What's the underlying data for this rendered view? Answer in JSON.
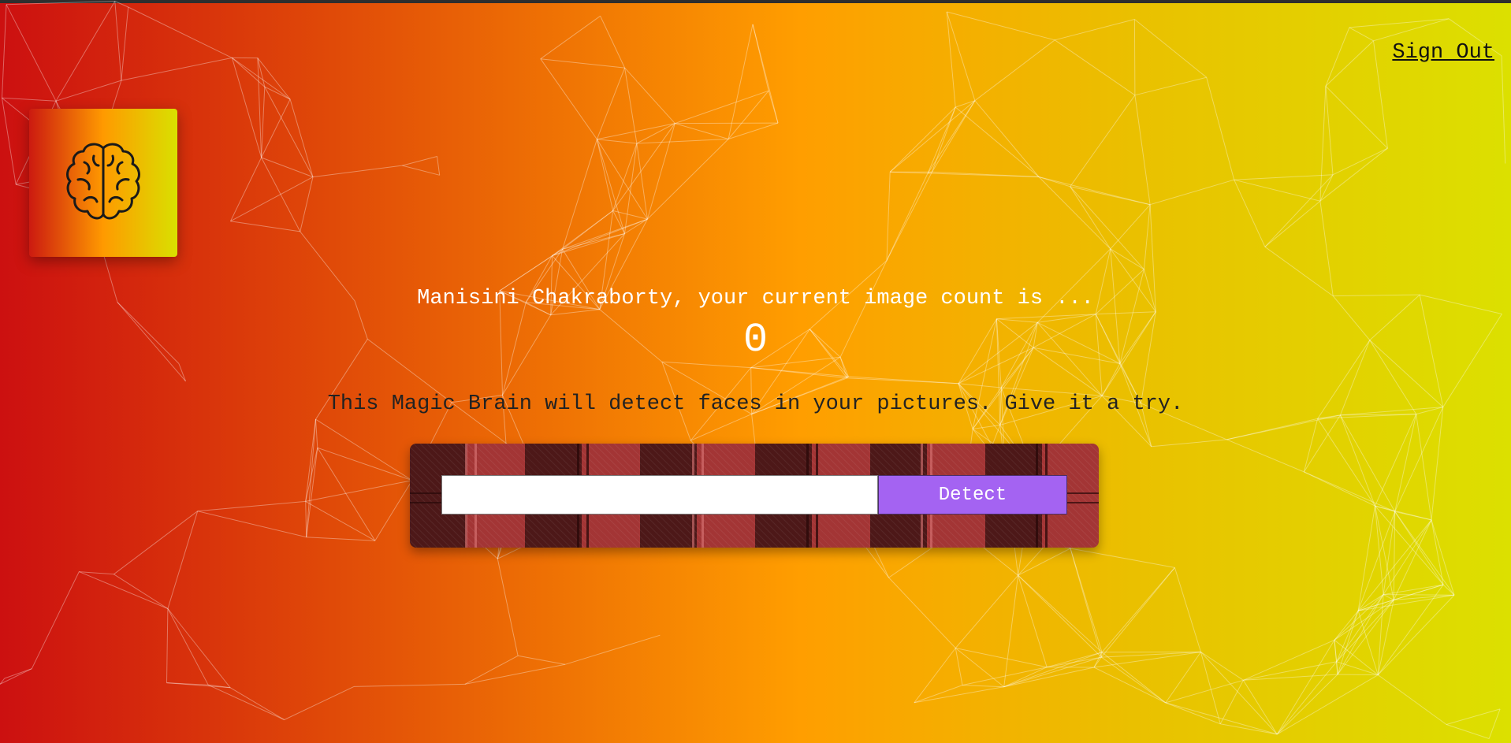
{
  "nav": {
    "sign_out_label": "Sign Out"
  },
  "logo": {
    "icon": "brain-icon"
  },
  "rank": {
    "message": "Manisini Chakraborty, your current image count is ...",
    "count": "0"
  },
  "instructions": {
    "text": "This Magic Brain will detect faces in your pictures. Give it a try."
  },
  "image_form": {
    "input_value": "",
    "button_label": "Detect"
  },
  "colors": {
    "accent_button": "#a463f2",
    "gradient_left": "#cc1010",
    "gradient_mid": "#ff9e00",
    "gradient_right": "#dce000"
  }
}
